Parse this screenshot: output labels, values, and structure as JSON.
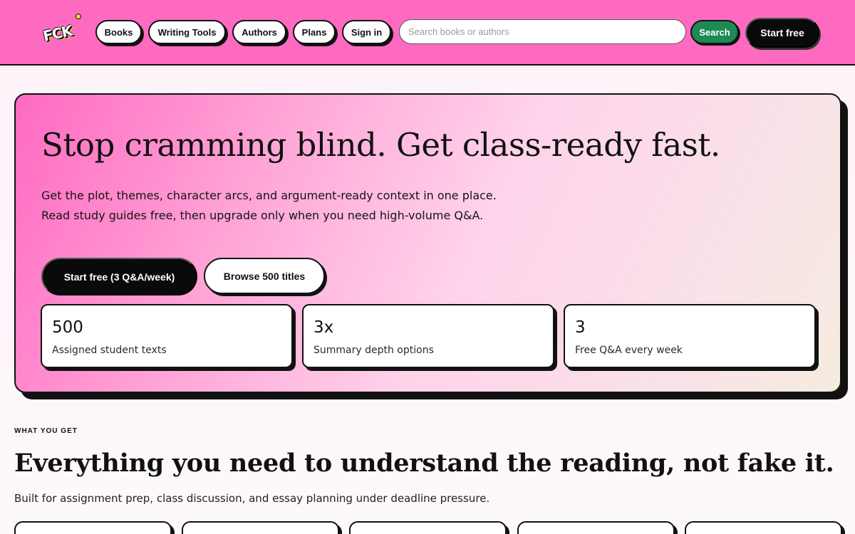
{
  "header": {
    "logo_text": "FCK",
    "nav": [
      "Books",
      "Writing Tools",
      "Authors",
      "Plans",
      "Sign in"
    ],
    "search_placeholder": "Search books or authors",
    "search_value": "",
    "search_button": "Search",
    "start_button": "Start free",
    "colors": {
      "background": "#ff6ac1",
      "search_button": "#1c8a55"
    }
  },
  "hero": {
    "title": "Stop cramming blind. Get class-ready fast.",
    "subtitle": "Get the plot, themes, character arcs, and argument-ready context in one place. Read study guides free, then upgrade only when you need high-volume Q&A.",
    "cta_primary": "Start free (3 Q&A/week)",
    "cta_secondary": "Browse 500 titles",
    "stats": [
      {
        "value": "500",
        "label": "Assigned student texts"
      },
      {
        "value": "3x",
        "label": "Summary depth options"
      },
      {
        "value": "3",
        "label": "Free Q&A every week"
      }
    ]
  },
  "features": {
    "eyebrow": "WHAT YOU GET",
    "title": "Everything you need to understand the reading, not fake it.",
    "subtitle": "Built for assignment prep, class discussion, and essay planning under deadline pressure."
  }
}
